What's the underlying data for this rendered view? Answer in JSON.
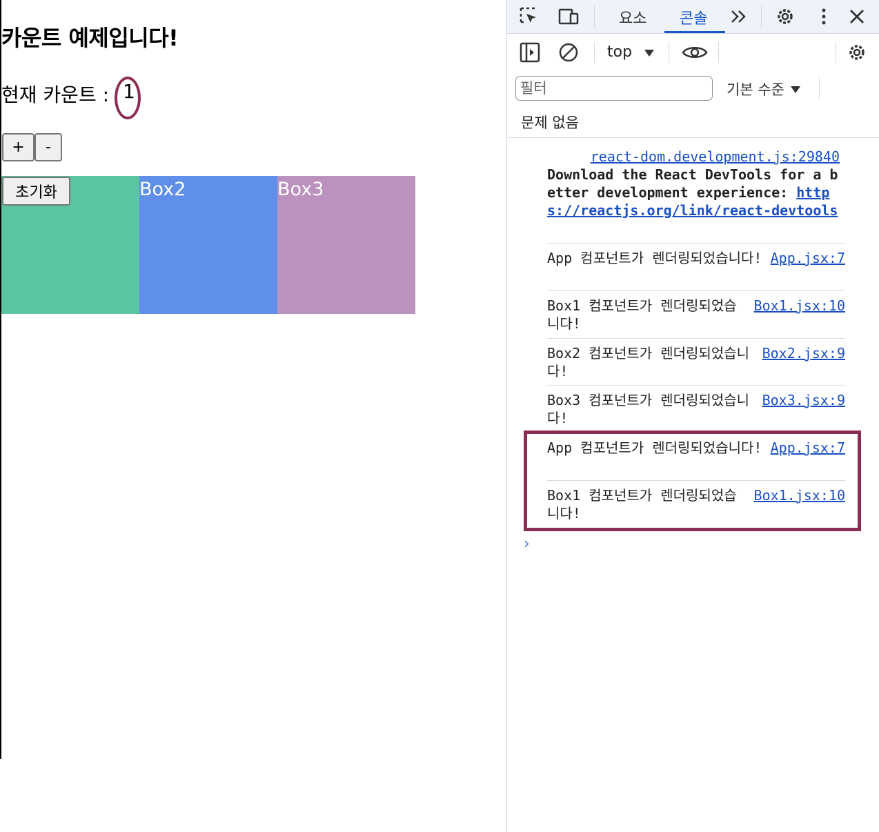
{
  "app": {
    "title": "카운트 예제입니다!",
    "count_label": "현재 카운트 :",
    "count_value": "1",
    "plus_label": "+",
    "minus_label": "-",
    "reset_label": "초기화",
    "boxes": [
      {
        "label": "",
        "color": "#5bc4a0"
      },
      {
        "label": "Box2",
        "color": "#5f8fe8"
      },
      {
        "label": "Box3",
        "color": "#bb91bd"
      }
    ],
    "highlight_color": "#8c2c55"
  },
  "devtools": {
    "tabs": [
      {
        "label": "요소",
        "active": false
      },
      {
        "label": "콘솔",
        "active": true
      }
    ],
    "context": "top",
    "filter_placeholder": "필터",
    "level_label": "기본 수준",
    "issues_label": "문제 없음",
    "accent_color": "#1a57c8",
    "messages": [
      {
        "source": "react-dom.development.js:29840",
        "text": "Download the React DevTools for a better development experience: ",
        "link": "https://reactjs.org/link/react-devtools"
      },
      {
        "source": "App.jsx:7",
        "text": "App 컴포넌트가 렌더링되었습니다!"
      },
      {
        "source": "Box1.jsx:10",
        "text": "Box1 컴포넌트가 렌더링되었습니다!"
      },
      {
        "source": "Box2.jsx:9",
        "text": "Box2 컴포넌트가 렌더링되었습니다!"
      },
      {
        "source": "Box3.jsx:9",
        "text": "Box3 컴포넌트가 렌더링되었습니다!"
      },
      {
        "source": "App.jsx:7",
        "text": "App 컴포넌트가 렌더링되었습니다!"
      },
      {
        "source": "Box1.jsx:10",
        "text": "Box1 컴포넌트가 렌더링되었습니다!"
      }
    ],
    "prompt_symbol": "›"
  }
}
